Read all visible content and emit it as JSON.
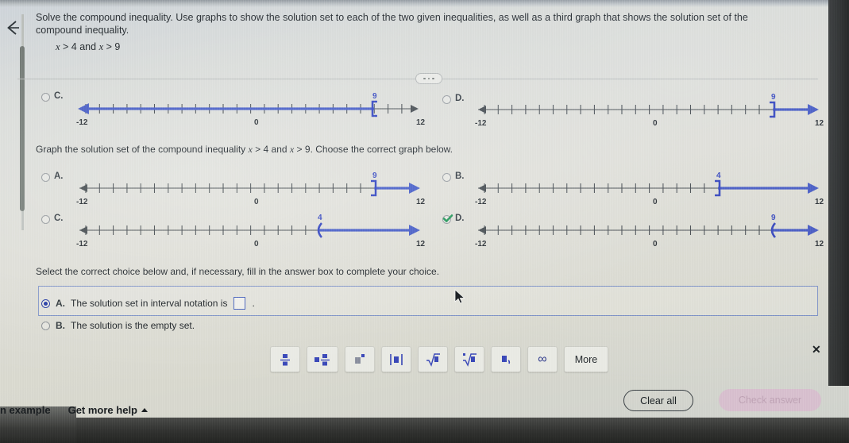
{
  "header": {
    "back_icon": "back-arrow-icon",
    "prompt": "Solve the compound inequality. Use graphs to show the solution set to each of the two given inequalities, as well as a third graph that shows the solution set of the compound inequality.",
    "inequality_x": "x",
    "inequality_rest": " > 4 and ",
    "inequality_x2": "x",
    "inequality_rest2": " > 9"
  },
  "divider": {
    "ellipsis": "…"
  },
  "top_graphs": [
    {
      "letter": "C.",
      "selected": false,
      "checked": false,
      "left_label": "-12",
      "right_label": "12",
      "zero_label": "0",
      "point_label": "9",
      "point_value": 9,
      "endpoint": "bracket",
      "direction": "left"
    },
    {
      "letter": "D.",
      "selected": false,
      "checked": false,
      "left_label": "-12",
      "right_label": "12",
      "zero_label": "0",
      "point_label": "9",
      "point_value": 9,
      "endpoint": "bracket",
      "direction": "right"
    }
  ],
  "subprompt": {
    "part1": "Graph the solution set of the compound inequality ",
    "x1": "x",
    "mid1": " > 4 and ",
    "x2": "x",
    "mid2": " > 9",
    "part2": ". Choose the correct graph below."
  },
  "answer_graphs": [
    {
      "letter": "A.",
      "selected": false,
      "checked": false,
      "left_label": "-12",
      "right_label": "12",
      "zero_label": "0",
      "point_label": "9",
      "point_value": 9,
      "endpoint": "bracket",
      "direction": "right"
    },
    {
      "letter": "B.",
      "selected": false,
      "checked": false,
      "left_label": "-12",
      "right_label": "12",
      "zero_label": "0",
      "point_label": "4",
      "point_value": 4,
      "endpoint": "bracket",
      "direction": "right"
    },
    {
      "letter": "C.",
      "selected": false,
      "checked": false,
      "left_label": "-12",
      "right_label": "12",
      "zero_label": "0",
      "point_label": "4",
      "point_value": 4,
      "endpoint": "paren",
      "direction": "right"
    },
    {
      "letter": "D.",
      "selected": false,
      "checked": true,
      "left_label": "-12",
      "right_label": "12",
      "zero_label": "0",
      "point_label": "9",
      "point_value": 9,
      "endpoint": "paren",
      "direction": "right"
    }
  ],
  "choice_section": {
    "prompt": "Select the correct choice below and, if necessary, fill in the answer box to complete your choice.",
    "options": [
      {
        "letter": "A.",
        "text_before": "The solution set in interval notation is",
        "has_input": true,
        "input_value": "",
        "text_after": ".",
        "selected": true
      },
      {
        "letter": "B.",
        "text_before": "The solution is the empty set.",
        "has_input": false,
        "input_value": "",
        "text_after": "",
        "selected": false
      }
    ]
  },
  "math_toolbar": {
    "close_label": "✕",
    "buttons": [
      {
        "name": "fraction",
        "label": "fraction-icon"
      },
      {
        "name": "mixed-number",
        "label": "mixed-number-icon"
      },
      {
        "name": "exponent",
        "label": "exponent-icon"
      },
      {
        "name": "absolute-value",
        "label": "absolute-value-icon"
      },
      {
        "name": "square-root",
        "label": "square-root-icon"
      },
      {
        "name": "nth-root",
        "label": "nth-root-icon"
      },
      {
        "name": "comma-list",
        "label": "comma-list-icon"
      },
      {
        "name": "infinity",
        "label": "∞"
      },
      {
        "name": "more",
        "label": "More"
      }
    ]
  },
  "footer": {
    "view_example": "n example",
    "get_more_help": "Get more help",
    "clear_all": "Clear all",
    "check_answer": "Check answer"
  },
  "colors": {
    "accent_blue": "#4a5bbf",
    "axis_gray": "#4a4f52",
    "selected_radio": "#2c3fa0",
    "check_green": "#2e8b57",
    "check_button_bg": "#d8c0cf"
  }
}
